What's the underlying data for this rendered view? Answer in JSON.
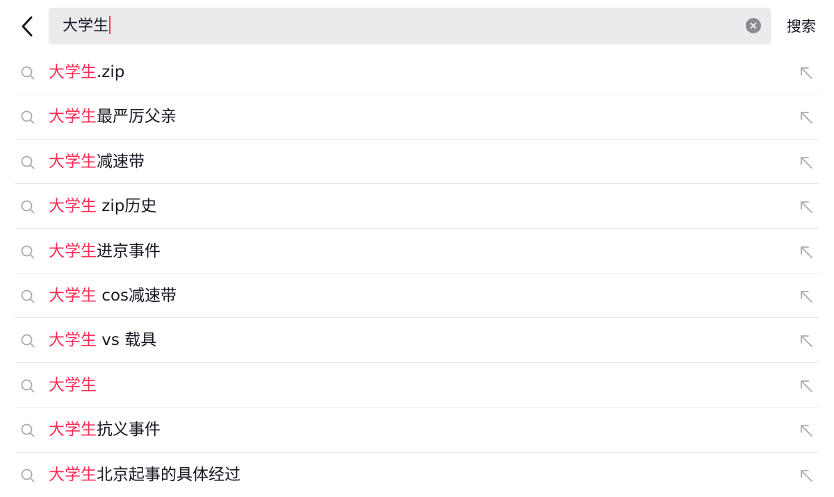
{
  "header": {
    "back_icon": "chevron-left-icon",
    "query": "大学生",
    "clear_icon": "clear-circle-icon",
    "submit_label": "搜索"
  },
  "accent_color": "#fe2c55",
  "suggestions": [
    {
      "highlight": "大学生",
      "rest": ".zip"
    },
    {
      "highlight": "大学生",
      "rest": "最严厉父亲"
    },
    {
      "highlight": "大学生",
      "rest": "减速带"
    },
    {
      "highlight": "大学生",
      "rest": " zip历史"
    },
    {
      "highlight": "大学生",
      "rest": "进京事件"
    },
    {
      "highlight": "大学生",
      "rest": " cos减速带"
    },
    {
      "highlight": "大学生",
      "rest": " vs 载具"
    },
    {
      "highlight": "大学生",
      "rest": ""
    },
    {
      "highlight": "大学生",
      "rest": "抗义事件"
    },
    {
      "highlight": "大学生",
      "rest": "北京起事的具体经过"
    }
  ]
}
